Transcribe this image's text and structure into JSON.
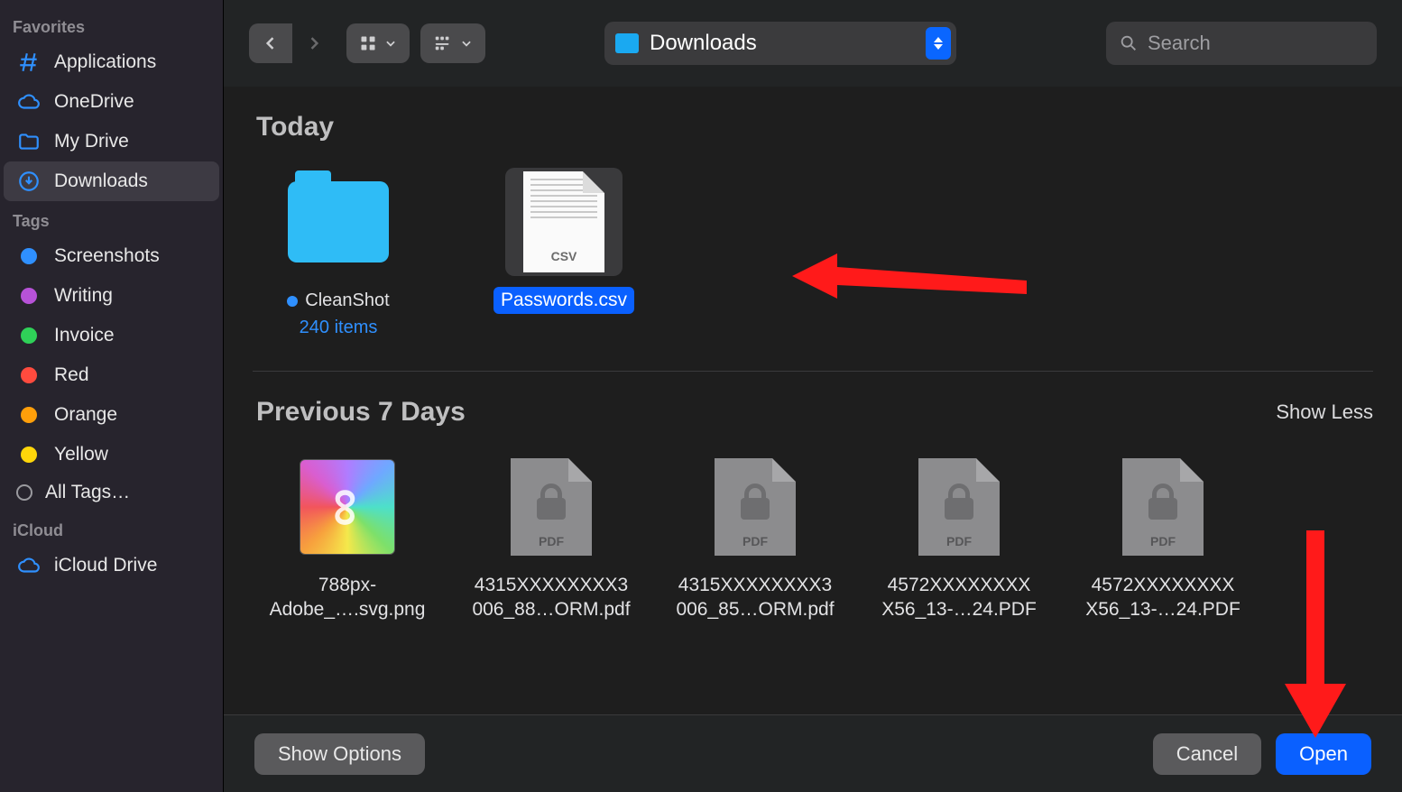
{
  "sidebar": {
    "sections": {
      "favorites": {
        "title": "Favorites",
        "items": [
          {
            "label": "Applications",
            "icon": "apps"
          },
          {
            "label": "OneDrive",
            "icon": "cloud"
          },
          {
            "label": "My Drive",
            "icon": "folder"
          },
          {
            "label": "Downloads",
            "icon": "download",
            "active": true
          }
        ]
      },
      "tags": {
        "title": "Tags",
        "items": [
          {
            "label": "Screenshots",
            "color": "#2f90ff"
          },
          {
            "label": "Writing",
            "color": "#b752d8"
          },
          {
            "label": "Invoice",
            "color": "#2fd158"
          },
          {
            "label": "Red",
            "color": "#ff4b3e"
          },
          {
            "label": "Orange",
            "color": "#ff9f0a"
          },
          {
            "label": "Yellow",
            "color": "#ffd60a"
          }
        ],
        "all_tags_label": "All Tags…"
      },
      "icloud": {
        "title": "iCloud",
        "items": [
          {
            "label": "iCloud Drive",
            "icon": "cloud"
          }
        ]
      }
    }
  },
  "toolbar": {
    "current_folder": "Downloads",
    "search_placeholder": "Search"
  },
  "groups": [
    {
      "title": "Today",
      "show_less": false,
      "items": [
        {
          "kind": "folder",
          "name": "CleanShot",
          "sub": "240 items",
          "tagged": true
        },
        {
          "kind": "csv",
          "name": "Passwords.csv",
          "selected": true,
          "type_label": "CSV"
        }
      ]
    },
    {
      "title": "Previous 7 Days",
      "show_less": true,
      "show_less_label": "Show Less",
      "items": [
        {
          "kind": "adobe",
          "name_line1": "788px-",
          "name_line2": "Adobe_….svg.png"
        },
        {
          "kind": "pdf",
          "name_line1": "4315XXXXXXXX3",
          "name_line2": "006_88…ORM.pdf",
          "type_label": "PDF"
        },
        {
          "kind": "pdf",
          "name_line1": "4315XXXXXXXX3",
          "name_line2": "006_85…ORM.pdf",
          "type_label": "PDF"
        },
        {
          "kind": "pdf",
          "name_line1": "4572XXXXXXXX",
          "name_line2": "X56_13-…24.PDF",
          "type_label": "PDF"
        },
        {
          "kind": "pdf",
          "name_line1": "4572XXXXXXXX",
          "name_line2": "X56_13-…24.PDF",
          "type_label": "PDF"
        }
      ]
    }
  ],
  "footer": {
    "show_options": "Show Options",
    "cancel": "Cancel",
    "open": "Open"
  },
  "colors": {
    "accent": "#0a60ff",
    "sidebar_icon": "#2f90ff"
  }
}
